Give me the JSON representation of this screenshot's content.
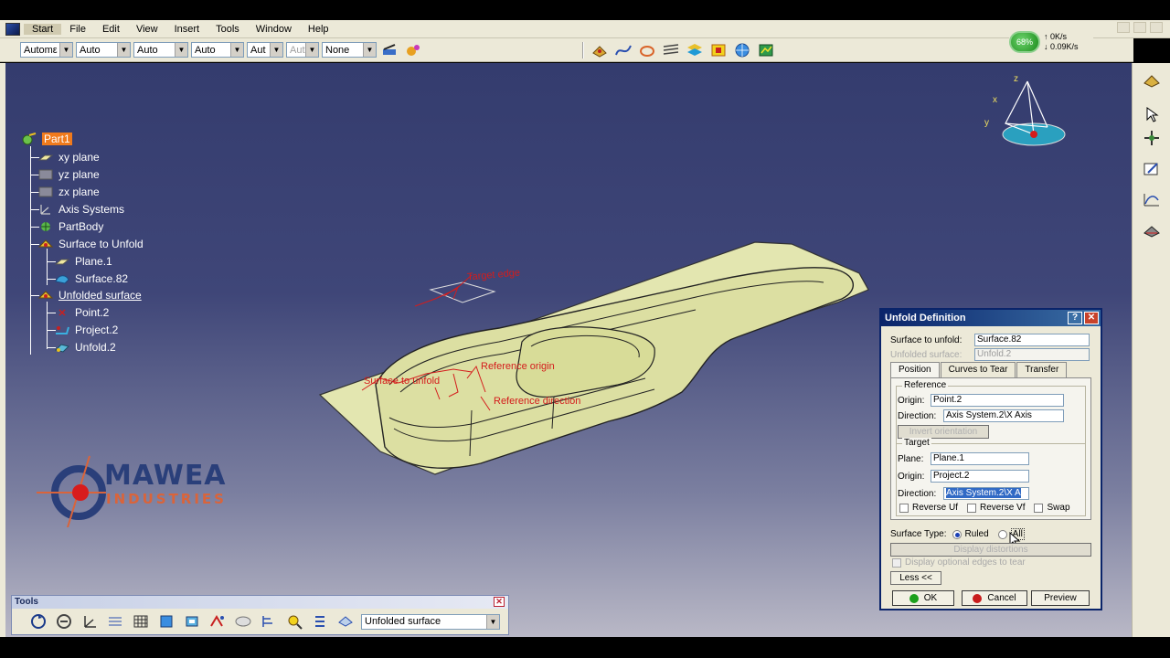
{
  "menu": {
    "items": [
      "Start",
      "File",
      "Edit",
      "View",
      "Insert",
      "Tools",
      "Window",
      "Help"
    ]
  },
  "toolbar": {
    "combos": [
      {
        "value": "Automε",
        "disabled": false
      },
      {
        "value": "Auto",
        "disabled": false
      },
      {
        "value": "Auto",
        "disabled": false
      },
      {
        "value": "Auto",
        "disabled": false
      },
      {
        "value": "Aut",
        "disabled": false
      },
      {
        "value": "Aut",
        "disabled": true
      },
      {
        "value": "None",
        "disabled": false
      }
    ]
  },
  "netmeter": {
    "percent": "68%",
    "up": "0K/s",
    "down": "0.09K/s"
  },
  "tree": {
    "root": "Part1",
    "items": [
      {
        "label": "xy plane"
      },
      {
        "label": "yz plane"
      },
      {
        "label": "zx plane"
      },
      {
        "label": "Axis Systems"
      },
      {
        "label": "PartBody"
      },
      {
        "label": "Surface to Unfold"
      },
      {
        "label": "Plane.1"
      },
      {
        "label": "Surface.82"
      },
      {
        "label": "Unfolded surface"
      },
      {
        "label": "Point.2"
      },
      {
        "label": "Project.2"
      },
      {
        "label": "Unfold.2"
      }
    ]
  },
  "annotations": {
    "surface_to_unfold": "Surface to unfold",
    "reference_origin": "Reference origin",
    "reference_direction": "Reference direction",
    "target_edge": "Target edge"
  },
  "logo": {
    "word1": "MAWEA",
    "word2": "INDUSTRIES"
  },
  "tools_palette": {
    "title": "Tools",
    "combo_value": "Unfolded surface"
  },
  "dialog": {
    "title": "Unfold Definition",
    "surface_to_unfold_label": "Surface to unfold:",
    "surface_to_unfold_value": "Surface.82",
    "unfolded_surface_label": "Unfolded surface:",
    "unfolded_surface_value": "Unfold.2",
    "tabs": [
      "Position",
      "Curves to Tear",
      "Transfer"
    ],
    "reference_group": "Reference",
    "ref_origin_label": "Origin:",
    "ref_origin_value": "Point.2",
    "ref_direction_label": "Direction:",
    "ref_direction_value": "Axis System.2\\X Axis",
    "invert_orientation": "Invert orientation",
    "target_group": "Target",
    "plane_label": "Plane:",
    "plane_value": "Plane.1",
    "tgt_origin_label": "Origin:",
    "tgt_origin_value": "Project.2",
    "tgt_direction_label": "Direction:",
    "tgt_direction_value": "Axis System.2\\X A",
    "reverse_uf": "Reverse Uf",
    "reverse_vf": "Reverse Vf",
    "swap": "Swap",
    "surface_type_label": "Surface Type:",
    "ruled": "Ruled",
    "all": "All",
    "display_distortions": "Display distortions",
    "display_optional_edges": "Display optional edges to tear",
    "less": "Less <<",
    "ok": "OK",
    "cancel": "Cancel",
    "preview": "Preview"
  },
  "colors": {
    "selection": "#f07a1c",
    "annotation": "#d41c1c",
    "part_fill": "#e3e6b0",
    "dialog_title": "#0a246a"
  }
}
